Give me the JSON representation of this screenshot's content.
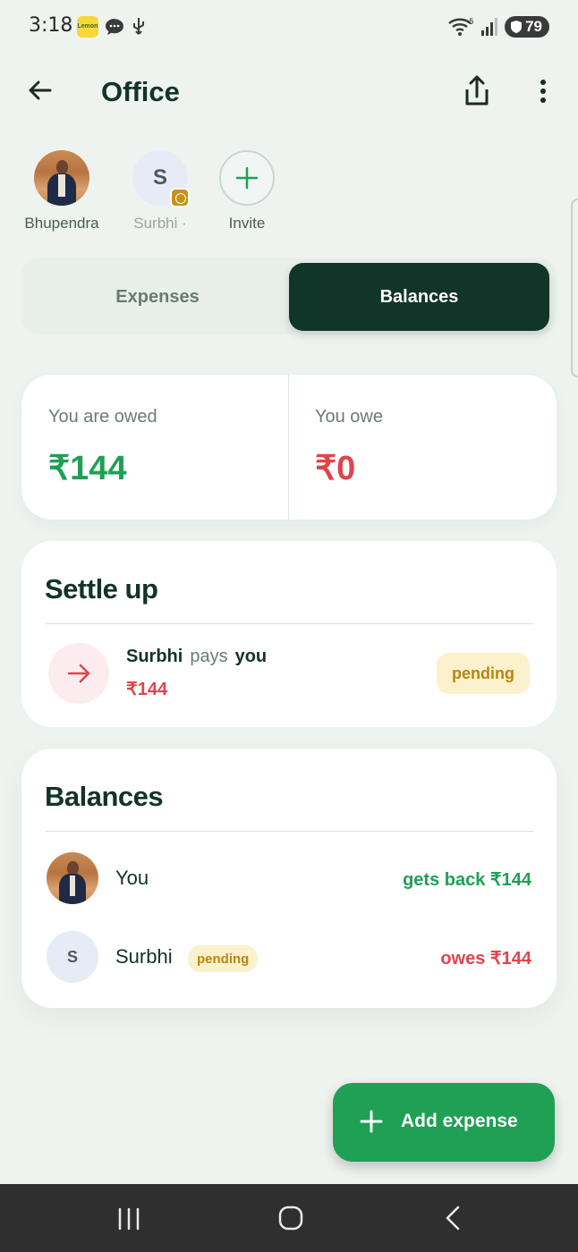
{
  "status_bar": {
    "time": "3:18",
    "app_icon_text": "Lemon",
    "battery": "79"
  },
  "header": {
    "title": "Office"
  },
  "members": [
    {
      "name": "Bhupendra",
      "avatar": "photo"
    },
    {
      "name": "Surbhi ·",
      "initial": "S"
    },
    {
      "name": "Invite"
    }
  ],
  "tabs": {
    "expenses": "Expenses",
    "balances": "Balances",
    "active": "Balances"
  },
  "summary": {
    "owed_label": "You are owed",
    "owed_value": "₹144",
    "owe_label": "You owe",
    "owe_value": "₹0"
  },
  "settle": {
    "title": "Settle up",
    "payer": "Surbhi",
    "verb": "pays",
    "payee": "you",
    "amount": "₹144",
    "status": "pending"
  },
  "balances": {
    "title": "Balances",
    "rows": [
      {
        "name": "You",
        "amount": "gets back ₹144"
      },
      {
        "name": "Surbhi",
        "initial": "S",
        "badge": "pending",
        "amount": "owes ₹144"
      }
    ]
  },
  "fab": {
    "label": "Add expense"
  },
  "colors": {
    "accent_green": "#1fa055",
    "negative_red": "#e0444c",
    "dark_green": "#12352a",
    "pending_bg": "#fbf1cc",
    "pending_text": "#b9860c"
  }
}
